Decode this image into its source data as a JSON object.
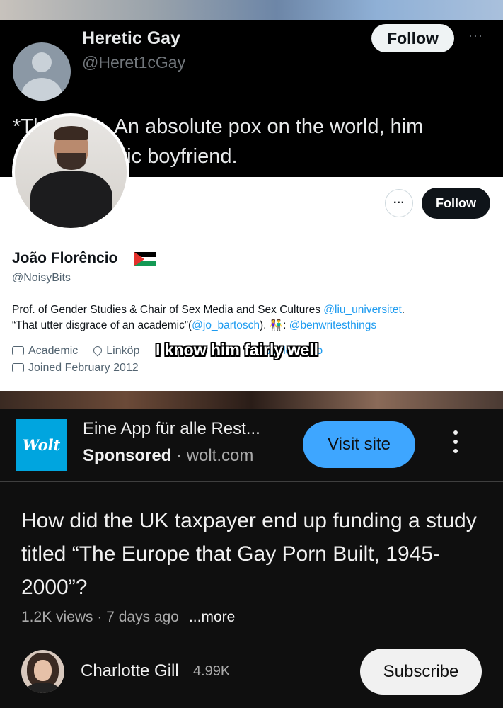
{
  "video_frame": {
    "tweet": {
      "author_name": "Heretic Gay",
      "author_handle": "@Heret1cGay",
      "follow_label": "Follow",
      "more_label": "···",
      "text_line1": "*Th      ick. An absolute pox on the world, him",
      "text_line2": "                 etic boyfriend."
    },
    "profile": {
      "more_label": "···",
      "follow_label": "Follow",
      "name": "João Florêncio",
      "flag_icon": "palestine-flag-icon",
      "handle": "@NoisyBits",
      "bio_line1_text": "Prof. of Gender Studies & Chair of Sex Media and Sex Cultures ",
      "bio_line1_link": "@liu_universitet",
      "bio_line1_end": ".",
      "bio_line2_text": "“That utter disgrace of an academic”(",
      "bio_line2_link1": "@jo_bartosch",
      "bio_line2_mid": "). 👫: ",
      "bio_line2_link2": "@benwritesthings",
      "category": "Academic",
      "location": "Linköp",
      "website_partial": "pmflorencio",
      "joined": "Joined February 2012"
    },
    "caption": "I know him fairly well"
  },
  "ad": {
    "logo_text": "Wolt",
    "title": "Eine App für alle Rest...",
    "sponsored_label": "Sponsored",
    "separator": " · ",
    "domain": "wolt.com",
    "cta_label": "Visit site",
    "menu_icon": "kebab-menu-icon"
  },
  "video": {
    "title": "How did the UK taxpayer end up funding a study titled “The Europe that Gay Porn Built, 1945-2000”?",
    "views": "1.2K views",
    "age": "7 days ago",
    "more_label": "...more"
  },
  "channel": {
    "name": "Charlotte Gill",
    "subscribers": "4.99K",
    "subscribe_label": "Subscribe"
  },
  "colors": {
    "background": "#0f0f0f",
    "visit_button": "#3ea6ff",
    "wolt_brand": "#00a5df",
    "twitter_link": "#1d9bf0"
  }
}
